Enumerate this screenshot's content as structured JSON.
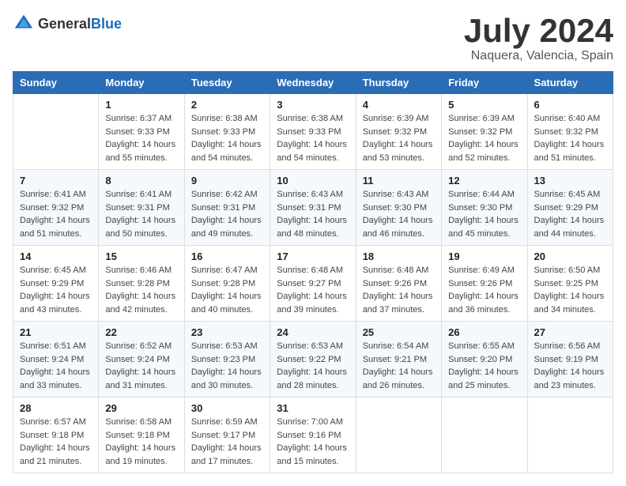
{
  "header": {
    "logo_general": "General",
    "logo_blue": "Blue",
    "month_title": "July 2024",
    "location": "Naquera, Valencia, Spain"
  },
  "days_of_week": [
    "Sunday",
    "Monday",
    "Tuesday",
    "Wednesday",
    "Thursday",
    "Friday",
    "Saturday"
  ],
  "weeks": [
    [
      {
        "day": "",
        "info": ""
      },
      {
        "day": "1",
        "info": "Sunrise: 6:37 AM\nSunset: 9:33 PM\nDaylight: 14 hours\nand 55 minutes."
      },
      {
        "day": "2",
        "info": "Sunrise: 6:38 AM\nSunset: 9:33 PM\nDaylight: 14 hours\nand 54 minutes."
      },
      {
        "day": "3",
        "info": "Sunrise: 6:38 AM\nSunset: 9:33 PM\nDaylight: 14 hours\nand 54 minutes."
      },
      {
        "day": "4",
        "info": "Sunrise: 6:39 AM\nSunset: 9:32 PM\nDaylight: 14 hours\nand 53 minutes."
      },
      {
        "day": "5",
        "info": "Sunrise: 6:39 AM\nSunset: 9:32 PM\nDaylight: 14 hours\nand 52 minutes."
      },
      {
        "day": "6",
        "info": "Sunrise: 6:40 AM\nSunset: 9:32 PM\nDaylight: 14 hours\nand 51 minutes."
      }
    ],
    [
      {
        "day": "7",
        "info": "Sunrise: 6:41 AM\nSunset: 9:32 PM\nDaylight: 14 hours\nand 51 minutes."
      },
      {
        "day": "8",
        "info": "Sunrise: 6:41 AM\nSunset: 9:31 PM\nDaylight: 14 hours\nand 50 minutes."
      },
      {
        "day": "9",
        "info": "Sunrise: 6:42 AM\nSunset: 9:31 PM\nDaylight: 14 hours\nand 49 minutes."
      },
      {
        "day": "10",
        "info": "Sunrise: 6:43 AM\nSunset: 9:31 PM\nDaylight: 14 hours\nand 48 minutes."
      },
      {
        "day": "11",
        "info": "Sunrise: 6:43 AM\nSunset: 9:30 PM\nDaylight: 14 hours\nand 46 minutes."
      },
      {
        "day": "12",
        "info": "Sunrise: 6:44 AM\nSunset: 9:30 PM\nDaylight: 14 hours\nand 45 minutes."
      },
      {
        "day": "13",
        "info": "Sunrise: 6:45 AM\nSunset: 9:29 PM\nDaylight: 14 hours\nand 44 minutes."
      }
    ],
    [
      {
        "day": "14",
        "info": "Sunrise: 6:45 AM\nSunset: 9:29 PM\nDaylight: 14 hours\nand 43 minutes."
      },
      {
        "day": "15",
        "info": "Sunrise: 6:46 AM\nSunset: 9:28 PM\nDaylight: 14 hours\nand 42 minutes."
      },
      {
        "day": "16",
        "info": "Sunrise: 6:47 AM\nSunset: 9:28 PM\nDaylight: 14 hours\nand 40 minutes."
      },
      {
        "day": "17",
        "info": "Sunrise: 6:48 AM\nSunset: 9:27 PM\nDaylight: 14 hours\nand 39 minutes."
      },
      {
        "day": "18",
        "info": "Sunrise: 6:48 AM\nSunset: 9:26 PM\nDaylight: 14 hours\nand 37 minutes."
      },
      {
        "day": "19",
        "info": "Sunrise: 6:49 AM\nSunset: 9:26 PM\nDaylight: 14 hours\nand 36 minutes."
      },
      {
        "day": "20",
        "info": "Sunrise: 6:50 AM\nSunset: 9:25 PM\nDaylight: 14 hours\nand 34 minutes."
      }
    ],
    [
      {
        "day": "21",
        "info": "Sunrise: 6:51 AM\nSunset: 9:24 PM\nDaylight: 14 hours\nand 33 minutes."
      },
      {
        "day": "22",
        "info": "Sunrise: 6:52 AM\nSunset: 9:24 PM\nDaylight: 14 hours\nand 31 minutes."
      },
      {
        "day": "23",
        "info": "Sunrise: 6:53 AM\nSunset: 9:23 PM\nDaylight: 14 hours\nand 30 minutes."
      },
      {
        "day": "24",
        "info": "Sunrise: 6:53 AM\nSunset: 9:22 PM\nDaylight: 14 hours\nand 28 minutes."
      },
      {
        "day": "25",
        "info": "Sunrise: 6:54 AM\nSunset: 9:21 PM\nDaylight: 14 hours\nand 26 minutes."
      },
      {
        "day": "26",
        "info": "Sunrise: 6:55 AM\nSunset: 9:20 PM\nDaylight: 14 hours\nand 25 minutes."
      },
      {
        "day": "27",
        "info": "Sunrise: 6:56 AM\nSunset: 9:19 PM\nDaylight: 14 hours\nand 23 minutes."
      }
    ],
    [
      {
        "day": "28",
        "info": "Sunrise: 6:57 AM\nSunset: 9:18 PM\nDaylight: 14 hours\nand 21 minutes."
      },
      {
        "day": "29",
        "info": "Sunrise: 6:58 AM\nSunset: 9:18 PM\nDaylight: 14 hours\nand 19 minutes."
      },
      {
        "day": "30",
        "info": "Sunrise: 6:59 AM\nSunset: 9:17 PM\nDaylight: 14 hours\nand 17 minutes."
      },
      {
        "day": "31",
        "info": "Sunrise: 7:00 AM\nSunset: 9:16 PM\nDaylight: 14 hours\nand 15 minutes."
      },
      {
        "day": "",
        "info": ""
      },
      {
        "day": "",
        "info": ""
      },
      {
        "day": "",
        "info": ""
      }
    ]
  ]
}
